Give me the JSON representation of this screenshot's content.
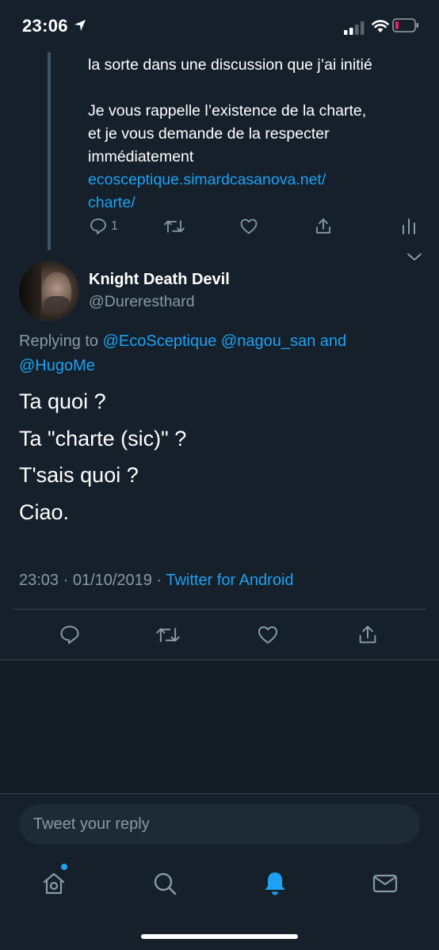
{
  "status_bar": {
    "time": "23:06",
    "icons": [
      "location-arrow-icon",
      "cellular-signal-icon",
      "wifi-icon",
      "battery-low-icon"
    ]
  },
  "previous_tweet": {
    "text_line_1": "la sorte dans une discussion que j’ai initié",
    "text_line_2": "Je vous rappelle l’existence de la charte,",
    "text_line_3": "et je vous demande de la respecter",
    "text_line_4": "immédiatement",
    "link_line_1": "ecosceptique.simardcasanova.net/",
    "link_line_2": "charte/",
    "reply_count": "1",
    "icons": [
      "reply-icon",
      "retweet-icon",
      "like-icon",
      "share-icon",
      "analytics-icon"
    ]
  },
  "tweet": {
    "author_name": "Knight Death Devil",
    "author_handle": "@Dureresthard",
    "replying_prefix": "Replying to",
    "mention_1": "@EcoSceptique",
    "mention_2": "@nagou_san",
    "replying_and": "and",
    "mention_3": "@HugoMe",
    "lines": [
      "Ta quoi ?",
      "Ta \"charte (sic)\" ?",
      "T'sais quoi ?",
      "Ciao."
    ],
    "timestamp": "23:03 · 01/10/2019 ·",
    "source": "Twitter for Android",
    "action_icons": [
      "reply-icon",
      "retweet-icon",
      "like-icon",
      "share-icon"
    ]
  },
  "reply_box": {
    "placeholder": "Tweet your reply"
  },
  "tab_bar": {
    "tabs": [
      "home-icon",
      "search-icon",
      "notifications-icon",
      "messages-icon"
    ],
    "active": "notifications-icon"
  },
  "colors": {
    "background": "#15202b",
    "accent": "#1da1f2",
    "secondary_text": "#8899a6",
    "divider": "#38444d",
    "battery_low": "#e0245e"
  }
}
